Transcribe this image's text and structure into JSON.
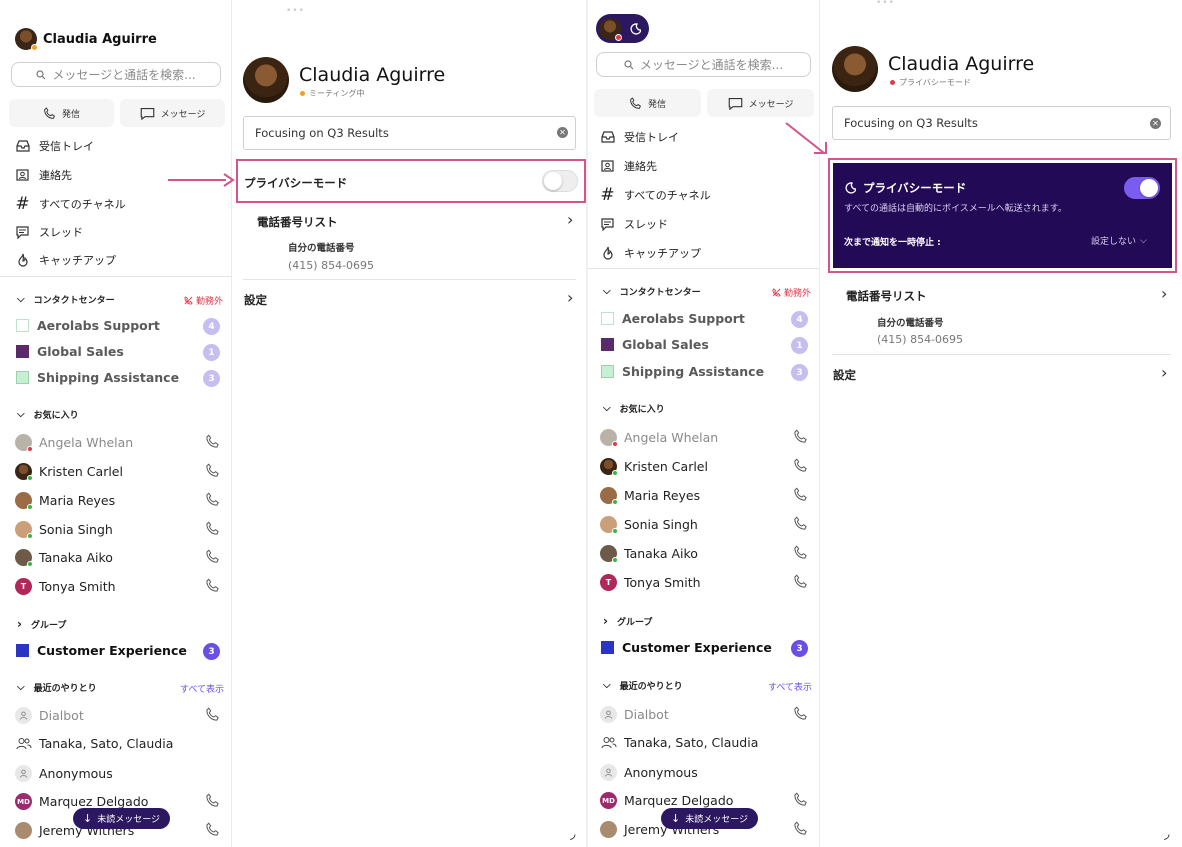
{
  "user": {
    "name": "Claudia  Aguirre",
    "status_meeting": "ミーティング中",
    "status_privacy": "プライバシーモード"
  },
  "search": {
    "placeholder": "メッセージと通話を検索..."
  },
  "actions": {
    "call": "発信",
    "message": "メッセージ"
  },
  "nav": [
    {
      "label": "受信トレイ",
      "icon": "inbox-icon"
    },
    {
      "label": "連絡先",
      "icon": "contacts-icon"
    },
    {
      "label": "すべてのチャネル",
      "icon": "hash-icon"
    },
    {
      "label": "スレッド",
      "icon": "thread-icon"
    },
    {
      "label": "キャッチアップ",
      "icon": "catchup-icon"
    }
  ],
  "contact_center": {
    "title": "コンタクトセンター",
    "status": "勤務外",
    "items": [
      {
        "name": "Aerolabs Support",
        "count": "4"
      },
      {
        "name": "Global Sales",
        "count": "1"
      },
      {
        "name": "Shipping Assistance",
        "count": "3"
      }
    ]
  },
  "favorites": {
    "title": "お気に入り",
    "items": [
      {
        "name": "Angela Whelan"
      },
      {
        "name": "Kristen Carlel"
      },
      {
        "name": "Maria Reyes"
      },
      {
        "name": "Sonia  Singh"
      },
      {
        "name": "Tanaka Aiko"
      },
      {
        "name": "Tonya Smith",
        "initials": "T"
      }
    ]
  },
  "groups": {
    "title": "グループ",
    "items": [
      {
        "name": "Customer Experience",
        "count": "3"
      }
    ]
  },
  "recent": {
    "title": "最近のやりとり",
    "show_all": "すべて表示",
    "items": [
      {
        "name": "Dialbot"
      },
      {
        "name": "Tanaka, Sato, Claudia"
      },
      {
        "name": "Anonymous"
      },
      {
        "name": "Marquez Delgado",
        "initials": "MD"
      },
      {
        "name": "Jeremy Withers"
      }
    ]
  },
  "unread_pill": "未読メッセージ",
  "detail": {
    "status_message": "Focusing on Q3 Results",
    "privacy_label": "プライバシーモード",
    "privacy_desc": "すべての通話は自動的にボイスメールへ転送されます。",
    "pause_label": "次まで通知を一時停止 :",
    "pause_value": "設定しない",
    "phone_list_title": "電話番号リスト",
    "my_number_label": "自分の電話番号",
    "my_number": "(415) 854-0695",
    "settings": "設定"
  },
  "colors": {
    "accent": "#6a4ee6",
    "privacy_panel": "#230a56",
    "highlight": "#d4548c",
    "arrow": "#d4548c",
    "off_duty": "#e0394a"
  }
}
